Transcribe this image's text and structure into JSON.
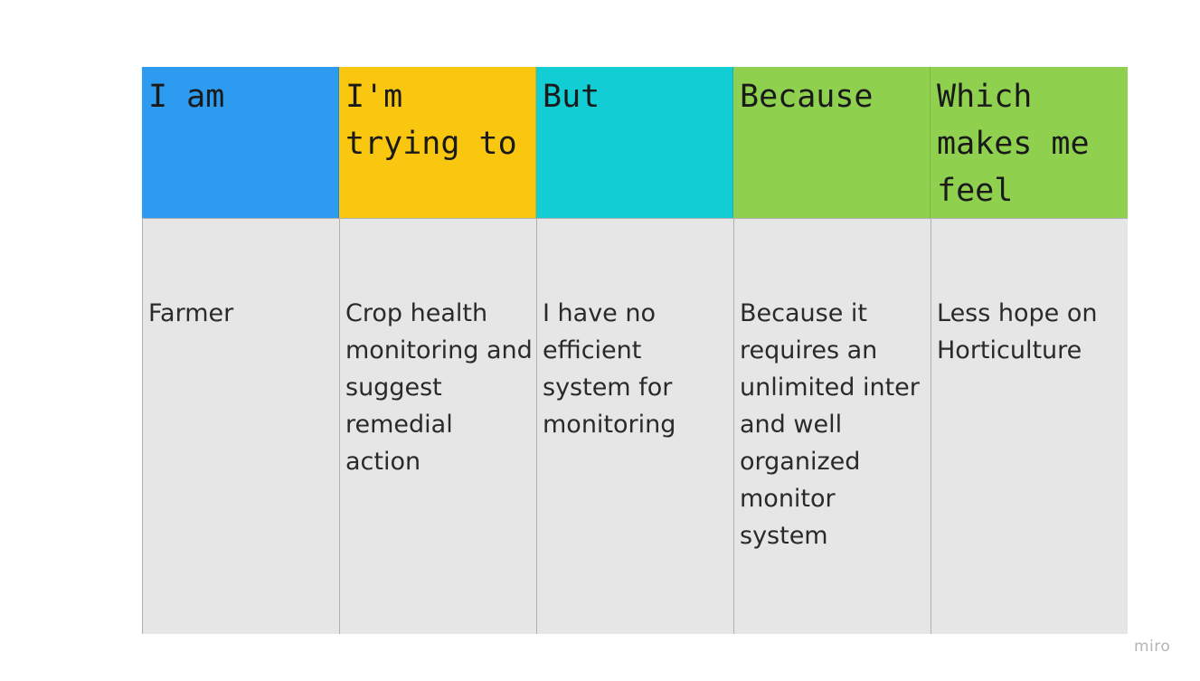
{
  "columns": [
    {
      "header": "I am",
      "color": "#2d9bf0",
      "body": "Farmer"
    },
    {
      "header": "I'm trying to",
      "color": "#fac710",
      "body": "Crop health monitoring and suggest remedial action"
    },
    {
      "header": "But",
      "color": "#12cdd4",
      "body": "I have no efficient system for monitoring"
    },
    {
      "header": "Because",
      "color": "#8fd14f",
      "body": "Because it requires an unlimited inter and well organized monitor system"
    },
    {
      "header": "Which makes me feel",
      "color": "#8fd14f",
      "body": "Less hope on Horticulture"
    }
  ],
  "watermark": "miro"
}
